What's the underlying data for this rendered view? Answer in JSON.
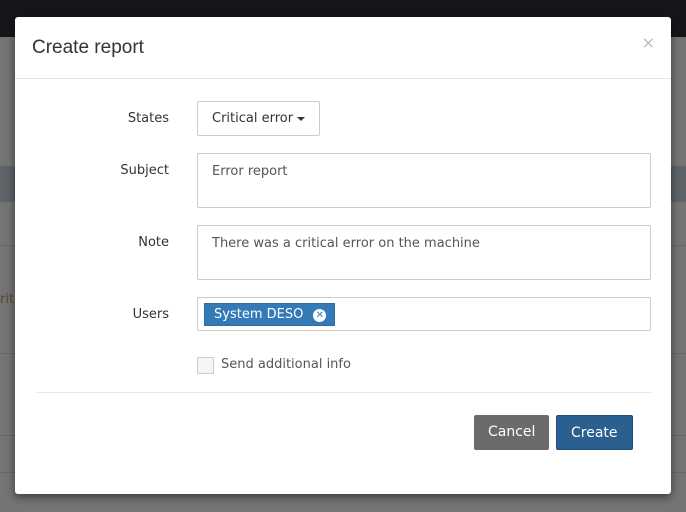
{
  "background": {
    "partial_text": "rit"
  },
  "modal": {
    "title": "Create report",
    "close_icon": "×",
    "states": {
      "label": "States",
      "value": "Critical error"
    },
    "subject": {
      "label": "Subject",
      "value": "Error report"
    },
    "note": {
      "label": "Note",
      "value": "There was a critical error on the machine"
    },
    "users": {
      "label": "Users",
      "tags": [
        "System DESO"
      ]
    },
    "send_info": {
      "label": "Send additional info",
      "checked": false
    },
    "cancel": "Cancel",
    "create": "Create"
  },
  "colors": {
    "primary": "#2a5f8f",
    "cancel": "#6b6b6b",
    "tag": "#337ab7"
  }
}
